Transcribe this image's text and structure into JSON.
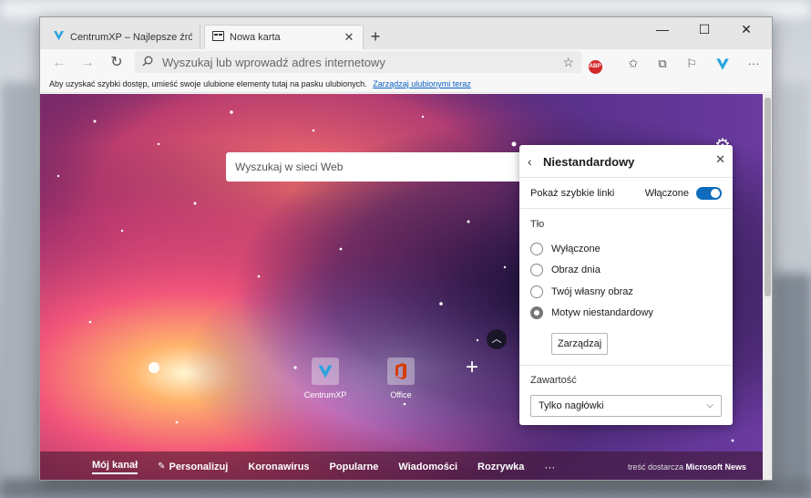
{
  "tabs": [
    {
      "title": "CentrumXP – Najlepsze źródło o"
    },
    {
      "title": "Nowa karta"
    }
  ],
  "toolbar": {
    "address_placeholder": "Wyszukaj lub wprowadź adres internetowy",
    "abp_label": "ABP"
  },
  "favorites_bar": {
    "message": "Aby uzyskać szybki dostęp, umieść swoje ulubione elementy tutaj na pasku ulubionych.",
    "link": "Zarządzaj ulubionymi teraz"
  },
  "newtab": {
    "search_placeholder": "Wyszukaj w sieci Web",
    "quick_links": [
      {
        "label": "CentrumXP"
      },
      {
        "label": "Office"
      }
    ],
    "news_tabs": [
      "Mój kanał",
      "Personalizuj",
      "Koronawirus",
      "Popularne",
      "Wiadomości",
      "Rozrywka"
    ],
    "news_more": "···",
    "provider_prefix": "treść dostarcza",
    "provider_name": "Microsoft News"
  },
  "panel": {
    "title": "Niestandardowy",
    "quick_links_label": "Pokaż szybkie linki",
    "quick_links_state": "Włączone",
    "quick_links_enabled": true,
    "background_label": "Tło",
    "background_options": [
      "Wyłączone",
      "Obraz dnia",
      "Twój własny obraz",
      "Motyw niestandardowy"
    ],
    "background_selected": "Motyw niestandardowy",
    "manage_button": "Zarządzaj",
    "content_label": "Zawartość",
    "content_value": "Tylko nagłówki"
  },
  "colors": {
    "accent": "#0f6cbd",
    "brand_centrumxp": "#2aa3e0",
    "office_red": "#d83b01"
  }
}
